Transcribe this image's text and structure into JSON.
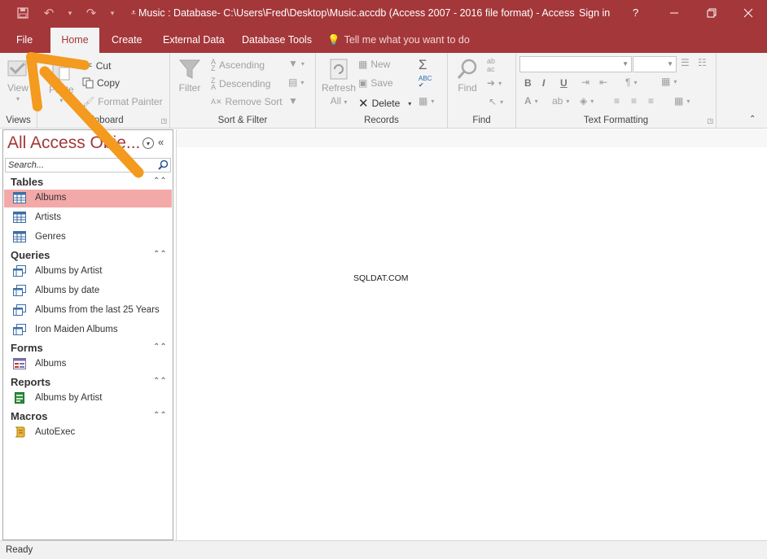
{
  "window": {
    "title": "Music : Database- C:\\Users\\Fred\\Desktop\\Music.accdb (Access 2007 - 2016 file format) - Access",
    "sign_in": "Sign in",
    "help": "?"
  },
  "tabs": [
    {
      "label": "File"
    },
    {
      "label": "Home",
      "active": true
    },
    {
      "label": "Create"
    },
    {
      "label": "External Data"
    },
    {
      "label": "Database Tools"
    }
  ],
  "tell_me": "Tell me what you want to do",
  "ribbon": {
    "views": {
      "view_label": "View",
      "group_label": "Views"
    },
    "clipboard": {
      "paste_label": "Paste",
      "cut": "Cut",
      "copy": "Copy",
      "format_painter": "Format Painter",
      "group_label": "Clipboard"
    },
    "sort_filter": {
      "filter": "Filter",
      "ascending": "Ascending",
      "descending": "Descending",
      "remove_sort": "Remove Sort",
      "group_label": "Sort & Filter"
    },
    "records": {
      "refresh": "Refresh",
      "refresh_all": "All",
      "new": "New",
      "save": "Save",
      "delete": "Delete",
      "group_label": "Records"
    },
    "find": {
      "find": "Find",
      "group_label": "Find"
    },
    "text_formatting": {
      "bold": "B",
      "italic": "I",
      "underline": "U",
      "group_label": "Text Formatting"
    }
  },
  "nav": {
    "title": "All Access Obje...",
    "search_placeholder": "Search...",
    "sections": [
      {
        "label": "Tables",
        "items": [
          {
            "label": "Albums",
            "icon": "table-icon",
            "selected": true
          },
          {
            "label": "Artists",
            "icon": "table-icon"
          },
          {
            "label": "Genres",
            "icon": "table-icon"
          }
        ]
      },
      {
        "label": "Queries",
        "items": [
          {
            "label": "Albums by Artist",
            "icon": "query-icon"
          },
          {
            "label": "Albums by date",
            "icon": "query-icon"
          },
          {
            "label": "Albums from the last 25 Years",
            "icon": "query-icon"
          },
          {
            "label": "Iron Maiden Albums",
            "icon": "query-icon"
          }
        ]
      },
      {
        "label": "Forms",
        "items": [
          {
            "label": "Albums",
            "icon": "form-icon"
          }
        ]
      },
      {
        "label": "Reports",
        "items": [
          {
            "label": "Albums by Artist",
            "icon": "report-icon"
          }
        ]
      },
      {
        "label": "Macros",
        "items": [
          {
            "label": "AutoExec",
            "icon": "macro-icon"
          }
        ]
      }
    ]
  },
  "watermark": "SQLDAT.COM",
  "status": "Ready",
  "colors": {
    "accent": "#a4373a",
    "selected": "#f4a9a9",
    "arrow": "#f39a1f"
  }
}
